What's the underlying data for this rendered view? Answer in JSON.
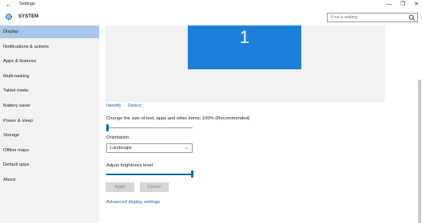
{
  "titlebar": {
    "back_icon": "back-arrow-icon",
    "title": "Settings",
    "minimize_symbol": "—",
    "maximize_symbol": "❐",
    "close_symbol": "✕"
  },
  "header": {
    "section_title": "SYSTEM",
    "search_placeholder": "Find a setting"
  },
  "sidebar": {
    "items": [
      {
        "label": "Display",
        "active": true
      },
      {
        "label": "Notifications & actions"
      },
      {
        "label": "Apps & features"
      },
      {
        "label": "Multi-tasking"
      },
      {
        "label": "Tablet mode"
      },
      {
        "label": "Battery saver"
      },
      {
        "label": "Power & sleep"
      },
      {
        "label": "Storage"
      },
      {
        "label": "Offline maps"
      },
      {
        "label": "Default apps"
      },
      {
        "label": "About"
      }
    ]
  },
  "main": {
    "monitor_number": "1",
    "identify_link": "Identify",
    "detect_link": "Detect",
    "scale_label": "Change the size of text, apps and other items: 100% (Recommended)",
    "scale_value": 0,
    "orientation_label": "Orientation",
    "orientation_value": "Landscape",
    "brightness_label": "Adjust brightness level",
    "brightness_value": 1,
    "apply_button": "Apply",
    "cancel_button": "Cancel",
    "advanced_link": "Advanced display settings"
  },
  "colors": {
    "accent": "#1464b4",
    "monitor": "#1c7fd8",
    "active_nav": "#a9c6e8",
    "sidebar_bg": "#f2f2f2"
  }
}
